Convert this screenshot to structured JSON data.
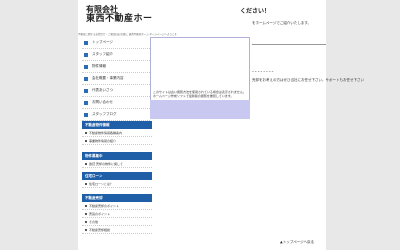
{
  "header": {
    "company_line1": "有限会社",
    "company_line2": "東西不動産ホー",
    "right_title": "ください！",
    "tagline": "をホームページでご紹介いたします。",
    "top_strip": "不動産に関するお問合せ・ご相談はお気軽に 東西不動産ホーム ホームページへようこそ"
  },
  "nav": {
    "items": [
      {
        "label": "トップページ"
      },
      {
        "label": "スタッフ紹介"
      },
      {
        "label": "物件情報"
      },
      {
        "label": "会社概要・事業内容"
      },
      {
        "label": "代表あいさつ"
      },
      {
        "label": "お問い合わせ"
      },
      {
        "label": "スタッフブログ"
      }
    ]
  },
  "popup": {
    "text": "このサイトは古い閲覧方法を使用されている場合は表示されません。ホームページ作成ソフトで最新版の閲覧を推奨しています。"
  },
  "right": {
    "dashes": "--------",
    "text": "売却をお考えの方はぜひ当社にお任せ下さい。サポートもお任せ下さい"
  },
  "side": {
    "sections": [
      {
        "head": "不動産物件情報",
        "links": [
          "不動産物件情報各種案内",
          "事業物件情報の紹介"
        ]
      },
      {
        "head": "物件募集中",
        "links": [
          "賃貸 売却の物件に関して"
        ]
      },
      {
        "head": "住宅ローン",
        "links": [
          "住宅ローンとは？"
        ]
      },
      {
        "head": "不動産売却",
        "links": [
          "不動産売却のポイント",
          "売買のポイント",
          "その他",
          "不動産売却相談"
        ]
      }
    ]
  },
  "footer": {
    "top_link": "▲トップページへ戻る"
  }
}
